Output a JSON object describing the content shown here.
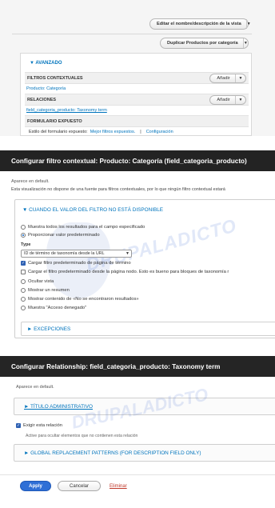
{
  "section1": {
    "edit_name_button": "Editar el nombre/descripción de la vista",
    "duplicate_button": "Duplicar Productos por categoría",
    "advanced_label": "▼ AVANZADO",
    "contextual_filters_heading": "FILTROS CONTEXTUALES",
    "add_label": "Añadir",
    "contextual_filter_item": "Producto: Categoría",
    "relationships_heading": "RELACIONES",
    "relationship_item": "field_categoria_producto: Taxonomy term",
    "exposed_form_heading": "FORMULARIO EXPUESTO",
    "exposed_style_label": "Estilo del formulario expuesto:",
    "exposed_style_value": "Mejor filtros expuestos.",
    "separator": "|",
    "configuration_link": "Configuración"
  },
  "section2": {
    "dialog_title": "Configurar filtro contextual: Producto: Categoría (field_categoria_producto)",
    "appears_in": "Aparece en default.",
    "no_source_note": "Esta visualización no dispone de una fuente para filtros contextuales, por lo que ningún filtro contextual estará",
    "when_unavailable_legend": "▼ CUANDO EL VALOR DEL FILTRO NO ESTÁ DISPONIBLE",
    "options": [
      "Muestra todos los resultados para el campo especificado",
      "Proporcionar valor predeterminado"
    ],
    "type_label": "Type",
    "type_select_value": "ID de término de taxonomía desde la URL",
    "checkbox_load_default": "Cargar filtro predeterminado de página de término",
    "checkbox_load_node": "Cargar el filtro predeterminado desde la página nodo. Esto es bueno para bloques de taxonomía r",
    "more_options": [
      "Ocultar vista",
      "Mostrar un resumen",
      "Mostrar contenido de «No se encontraron resultados»",
      "Muestra \"Acceso denegado\""
    ],
    "exceptions_label": "► EXCEPCIONES",
    "watermark": "DRUPALADICTO"
  },
  "section3": {
    "dialog_title": "Configurar Relationship: field_categoria_producto: Taxonomy term",
    "appears_in": "Aparece en default.",
    "admin_title_label": "► TÍTULO ADMINISTRATIVO",
    "require_relationship": "Exigir esta relación",
    "require_description": "Active para ocultar elementos que no contienen esta relación",
    "global_patterns_label": "► GLOBAL REPLACEMENT PATTERNS (FOR DESCRIPTION FIELD ONLY)",
    "apply_button": "Apply",
    "cancel_button": "Cancelar",
    "delete_link": "Eliminar",
    "watermark": "DRUPALADICTO"
  },
  "colors": {
    "link": "#0074bd",
    "titlebar": "#232323",
    "apply": "#2f6fd6",
    "delete": "#c0392b"
  }
}
